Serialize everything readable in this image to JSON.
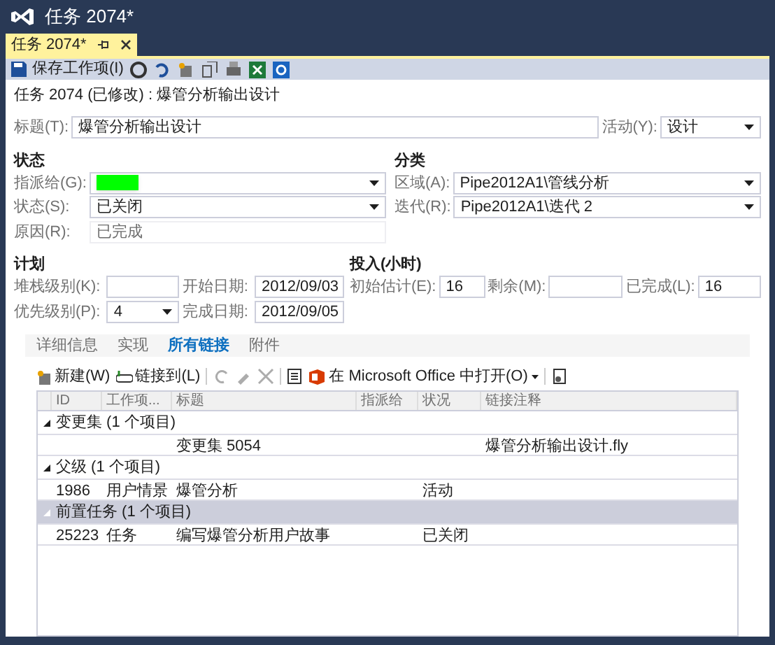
{
  "window": {
    "title": "任务 2074*"
  },
  "document_tab": {
    "label": "任务 2074*",
    "selected": true
  },
  "toolbar": {
    "save_label": "保存工作项(I)"
  },
  "heading": "任务 2074 (已修改) : 爆管分析输出设计",
  "title_field": {
    "label": "标题(T):",
    "value": "爆管分析输出设计"
  },
  "activity": {
    "label": "活动(Y):",
    "value": "设计"
  },
  "status_section": {
    "heading": "状态",
    "fields": [
      {
        "label": "指派给(G):",
        "kind": "dropdown",
        "redacted": true
      },
      {
        "label": "状态(S):",
        "kind": "dropdown",
        "value": "已关闭"
      },
      {
        "label": "原因(R):",
        "kind": "readonly",
        "value": "已完成"
      }
    ]
  },
  "classification_section": {
    "heading": "分类",
    "fields": [
      {
        "label": "区域(A):",
        "kind": "dropdown",
        "value": "Pipe2012A1\\管线分析"
      },
      {
        "label": "迭代(R):",
        "kind": "dropdown",
        "value": "Pipe2012A1\\迭代 2"
      }
    ]
  },
  "plan_section": {
    "heading": "计划",
    "fields": [
      {
        "label": "堆栈级别(K):",
        "kind": "text"
      },
      {
        "label": "开始日期:",
        "kind": "text",
        "value": "2012/09/03"
      },
      {
        "label": "优先级别(P):",
        "kind": "dropdown",
        "value": "4"
      },
      {
        "label": "完成日期:",
        "kind": "text",
        "value": "2012/09/05"
      }
    ]
  },
  "effort_section": {
    "heading": "投入(小时)",
    "fields": [
      {
        "label": "初始估计(E):",
        "kind": "text",
        "value": "16"
      },
      {
        "label": "剩余(M):",
        "kind": "text"
      },
      {
        "label": "已完成(L):",
        "kind": "text",
        "value": "16"
      }
    ]
  },
  "tabs": [
    {
      "label": "详细信息",
      "selected": false
    },
    {
      "label": "实现",
      "selected": false
    },
    {
      "label": "所有链接",
      "selected": true
    },
    {
      "label": "附件",
      "selected": false
    }
  ],
  "links_toolbar": {
    "new_label": "新建(W)",
    "link_to_label": "链接到(L)",
    "open_office_label": "在 Microsoft Office 中打开(O)"
  },
  "grid": {
    "columns": [
      "ID",
      "工作项...",
      "标题",
      "指派给",
      "状况",
      "链接注释"
    ],
    "groups": [
      {
        "label": "变更集 (1 个项目)",
        "expanded": true,
        "selected": false,
        "rows": [
          {
            "title": "变更集 5054",
            "link_comment": "爆管分析输出设计.fly"
          }
        ]
      },
      {
        "label": "父级 (1 个项目)",
        "expanded": true,
        "selected": false,
        "rows": [
          {
            "id": "1986",
            "type": "用户情景",
            "title": "爆管分析",
            "state": "活动"
          }
        ]
      },
      {
        "label": "前置任务 (1 个项目)",
        "expanded": true,
        "selected": true,
        "rows": [
          {
            "id": "25223",
            "type": "任务",
            "title": "编写爆管分析用户故事",
            "state": "已关闭"
          }
        ]
      }
    ]
  }
}
